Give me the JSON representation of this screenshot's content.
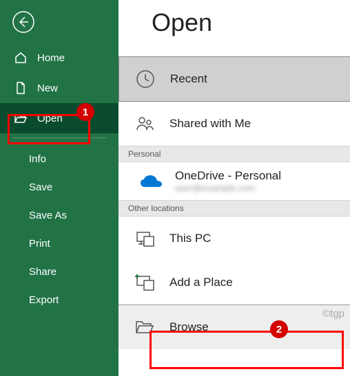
{
  "sidebar": {
    "items": [
      {
        "label": "Home"
      },
      {
        "label": "New"
      },
      {
        "label": "Open"
      }
    ],
    "sub_items": [
      {
        "label": "Info"
      },
      {
        "label": "Save"
      },
      {
        "label": "Save As"
      },
      {
        "label": "Print"
      },
      {
        "label": "Share"
      },
      {
        "label": "Export"
      }
    ]
  },
  "main": {
    "title": "Open",
    "recent": "Recent",
    "shared": "Shared with Me",
    "section_personal": "Personal",
    "onedrive_label": "OneDrive - Personal",
    "onedrive_sub": "user@example.com",
    "section_other": "Other locations",
    "this_pc": "This PC",
    "add_place": "Add a Place",
    "browse": "Browse"
  },
  "annotations": {
    "badge1": "1",
    "badge2": "2",
    "watermark": "©tgp"
  }
}
